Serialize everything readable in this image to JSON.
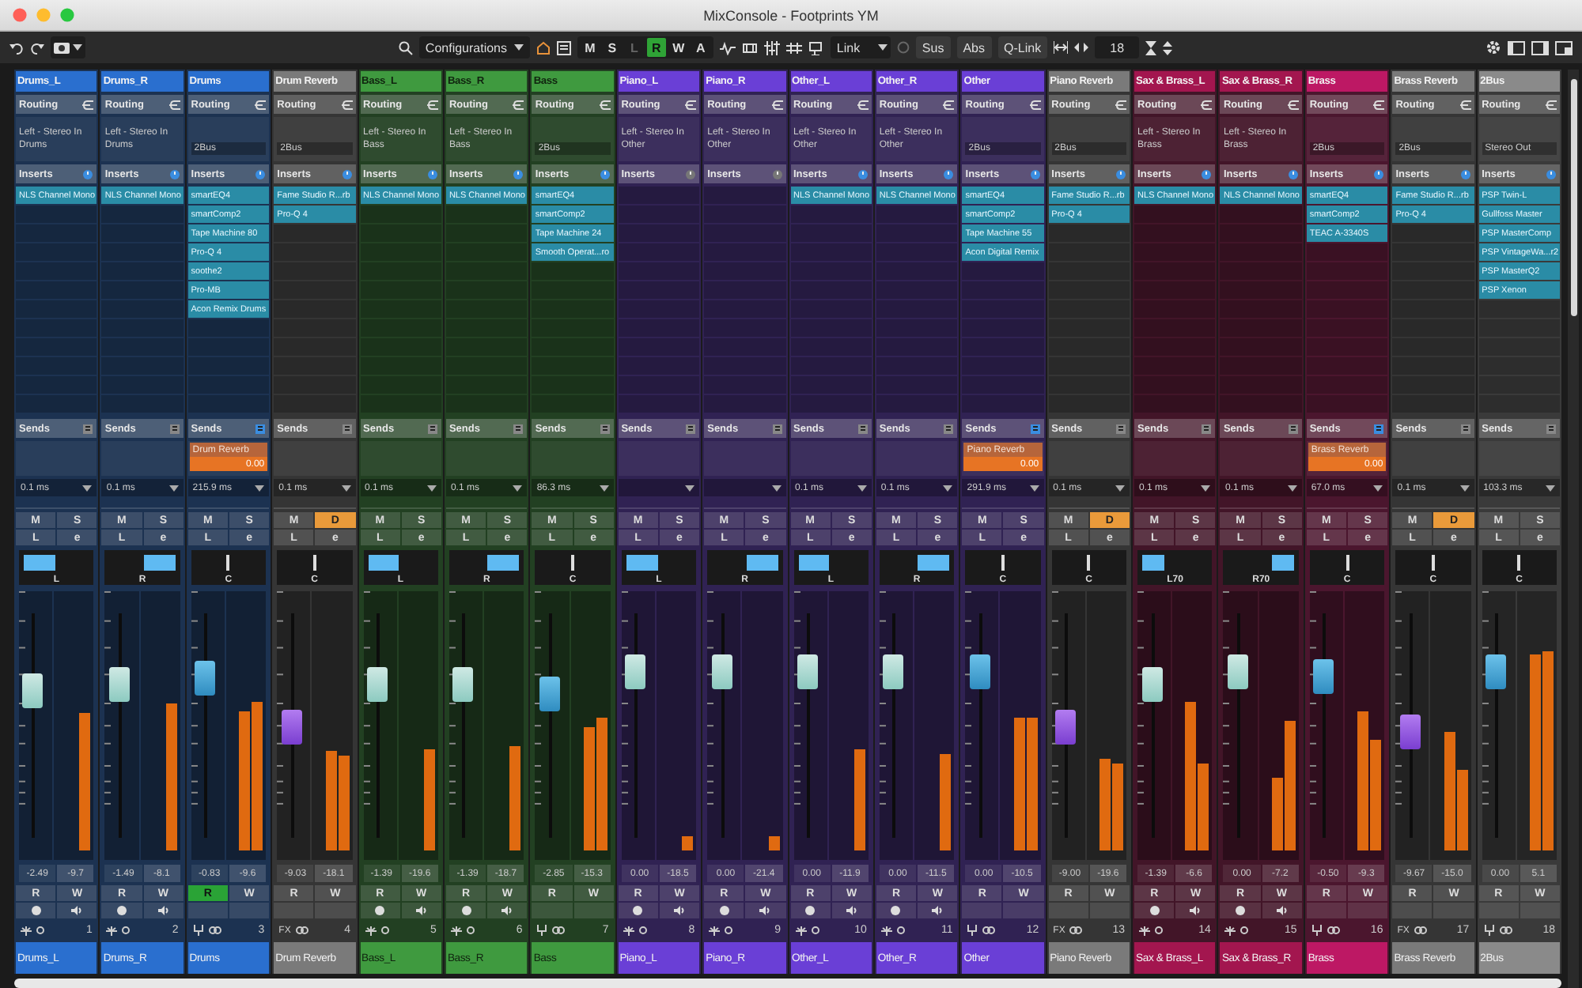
{
  "window": {
    "title": "MixConsole - Footprints YM"
  },
  "toolbar": {
    "configurations": "Configurations",
    "modes": [
      {
        "label": "M",
        "on": false,
        "disabled": false
      },
      {
        "label": "S",
        "on": false,
        "disabled": false
      },
      {
        "label": "L",
        "on": false,
        "disabled": true
      },
      {
        "label": "R",
        "on": true,
        "disabled": false
      },
      {
        "label": "W",
        "on": false,
        "disabled": false
      },
      {
        "label": "A",
        "on": false,
        "disabled": false
      }
    ],
    "link": "Link",
    "suspend": "Sus",
    "absolute": "Abs",
    "qlink": "Q-Link",
    "channel_count": "18"
  },
  "channels": [
    {
      "kind": "audio",
      "name": "Drums_L",
      "color": "#2a6fcf",
      "sections": [
        "Routing",
        "Inserts",
        "Sends"
      ],
      "input": "Left - Stereo In",
      "output": "Drums",
      "inserts_on": true,
      "inserts": [
        "NLS Channel Mono"
      ],
      "sends_on": false,
      "delay": "0.1 ms",
      "mute": "M",
      "solo": {
        "label": "S",
        "on": false
      },
      "listen": "L",
      "edit": "e",
      "pan": {
        "label": "L",
        "kind": "left"
      },
      "fader": {
        "level": 0.68
      },
      "meters": [
        {
          "level": 0.58
        }
      ],
      "volume": "-2.49",
      "peak": "-9.7",
      "read": {
        "label": "R",
        "on": false
      },
      "write": "W",
      "number": "1",
      "label": "Drums_L"
    },
    {
      "kind": "audio",
      "name": "Drums_R",
      "color": "#2a6fcf",
      "sections": [
        "Routing",
        "Inserts",
        "Sends"
      ],
      "input": "Left - Stereo In",
      "output": "Drums",
      "inserts_on": true,
      "inserts": [
        "NLS Channel Mono"
      ],
      "sends_on": false,
      "delay": "0.1 ms",
      "mute": "M",
      "solo": {
        "label": "S",
        "on": false
      },
      "listen": "L",
      "edit": "e",
      "pan": {
        "label": "R",
        "kind": "right"
      },
      "fader": {
        "level": 0.72
      },
      "meters": [
        {
          "level": 0.62
        }
      ],
      "volume": "-1.49",
      "peak": "-8.1",
      "read": {
        "label": "R",
        "on": false
      },
      "write": "W",
      "number": "2",
      "label": "Drums_R"
    },
    {
      "kind": "group",
      "name": "Drums",
      "color": "#2a6fcf",
      "sections": [
        "Routing",
        "Inserts",
        "Sends"
      ],
      "output": "2Bus",
      "inserts_on": true,
      "inserts": [
        "smartEQ4",
        "smartComp2",
        "Tape Machine 80",
        "Pro-Q 4",
        "soothe2",
        "Pro-MB",
        "Acon Remix Drums"
      ],
      "sends_on": true,
      "send": {
        "name": "Drum Reverb",
        "value": "0.00"
      },
      "delay": "215.9 ms",
      "mute": "M",
      "solo": {
        "label": "S",
        "on": false
      },
      "listen": "L",
      "edit": "e",
      "pan": {
        "label": "C",
        "kind": "center"
      },
      "fader": {
        "level": 0.75
      },
      "meters": [
        {
          "level": 0.59
        },
        {
          "level": 0.63
        }
      ],
      "volume": "-0.83",
      "peak": "-9.6",
      "read": {
        "label": "R",
        "on": true
      },
      "write": "W",
      "number": "3",
      "label": "Drums"
    },
    {
      "kind": "fx",
      "name": "Drum Reverb",
      "color": "#7a7a7a",
      "sections": [
        "Routing",
        "Inserts",
        "Sends"
      ],
      "output": "2Bus",
      "inserts_on": true,
      "inserts": [
        "Fame Studio R...rb",
        "Pro-Q 4"
      ],
      "sends_on": false,
      "delay": "0.1 ms",
      "mute": "M",
      "solo": {
        "label": "D",
        "on": true
      },
      "listen": "L",
      "edit": "e",
      "pan": {
        "label": "C",
        "kind": "center"
      },
      "fader": {
        "level": 0.49
      },
      "meters": [
        {
          "level": 0.42
        },
        {
          "level": 0.4
        }
      ],
      "volume": "-9.03",
      "peak": "-18.1",
      "read": {
        "label": "R",
        "on": false
      },
      "write": "W",
      "tag": "FX",
      "number": "4",
      "label": "Drum Reverb"
    },
    {
      "kind": "audio",
      "name": "Bass_L",
      "color": "#3f9a3f",
      "sections": [
        "Routing",
        "Inserts",
        "Sends"
      ],
      "input": "Left - Stereo In",
      "output": "Bass",
      "inserts_on": true,
      "inserts": [
        "NLS Channel Mono"
      ],
      "sends_on": false,
      "delay": "0.1 ms",
      "mute": "M",
      "solo": {
        "label": "S",
        "on": false
      },
      "listen": "L",
      "edit": "e",
      "pan": {
        "label": "L",
        "kind": "left"
      },
      "fader": {
        "level": 0.72
      },
      "meters": [
        {
          "level": 0.43
        }
      ],
      "volume": "-1.39",
      "peak": "-19.6",
      "read": {
        "label": "R",
        "on": false
      },
      "write": "W",
      "number": "5",
      "label": "Bass_L"
    },
    {
      "kind": "audio",
      "name": "Bass_R",
      "color": "#3f9a3f",
      "sections": [
        "Routing",
        "Inserts",
        "Sends"
      ],
      "input": "Left - Stereo In",
      "output": "Bass",
      "inserts_on": true,
      "inserts": [
        "NLS Channel Mono"
      ],
      "sends_on": false,
      "delay": "0.1 ms",
      "mute": "M",
      "solo": {
        "label": "S",
        "on": false
      },
      "listen": "L",
      "edit": "e",
      "pan": {
        "label": "R",
        "kind": "right"
      },
      "fader": {
        "level": 0.72
      },
      "meters": [
        {
          "level": 0.44
        }
      ],
      "volume": "-1.39",
      "peak": "-18.7",
      "read": {
        "label": "R",
        "on": false
      },
      "write": "W",
      "number": "6",
      "label": "Bass_R"
    },
    {
      "kind": "group",
      "name": "Bass",
      "color": "#3f9a3f",
      "sections": [
        "Routing",
        "Inserts",
        "Sends"
      ],
      "output": "2Bus",
      "inserts_on": true,
      "inserts": [
        "smartEQ4",
        "smartComp2",
        "Tape Machine 24",
        "Smooth Operat...ro"
      ],
      "sends_on": false,
      "delay": "86.3 ms",
      "mute": "M",
      "solo": {
        "label": "S",
        "on": false
      },
      "listen": "L",
      "edit": "e",
      "pan": {
        "label": "C",
        "kind": "center"
      },
      "fader": {
        "level": 0.67
      },
      "meters": [
        {
          "level": 0.52
        },
        {
          "level": 0.56
        }
      ],
      "volume": "-2.85",
      "peak": "-15.3",
      "read": {
        "label": "R",
        "on": false
      },
      "write": "W",
      "number": "7",
      "label": "Bass"
    },
    {
      "kind": "audio",
      "name": "Piano_L",
      "color": "#6a3fd6",
      "sections": [
        "Routing",
        "Inserts",
        "Sends"
      ],
      "input": "Left - Stereo In",
      "output": "Other",
      "inserts_on": false,
      "sends_on": false,
      "mute": "M",
      "solo": {
        "label": "S",
        "on": false
      },
      "listen": "L",
      "edit": "e",
      "pan": {
        "label": "L",
        "kind": "left"
      },
      "fader": {
        "level": 0.78
      },
      "meters": [
        {
          "level": 0.06
        }
      ],
      "volume": "0.00",
      "peak": "-18.5",
      "read": {
        "label": "R",
        "on": false
      },
      "write": "W",
      "number": "8",
      "label": "Piano_L"
    },
    {
      "kind": "audio",
      "name": "Piano_R",
      "color": "#6a3fd6",
      "sections": [
        "Routing",
        "Inserts",
        "Sends"
      ],
      "input": "Left - Stereo In",
      "output": "Other",
      "inserts_on": false,
      "sends_on": false,
      "mute": "M",
      "solo": {
        "label": "S",
        "on": false
      },
      "listen": "L",
      "edit": "e",
      "pan": {
        "label": "R",
        "kind": "right"
      },
      "fader": {
        "level": 0.78
      },
      "meters": [
        {
          "level": 0.06
        }
      ],
      "volume": "0.00",
      "peak": "-21.4",
      "read": {
        "label": "R",
        "on": false
      },
      "write": "W",
      "number": "9",
      "label": "Piano_R"
    },
    {
      "kind": "audio",
      "name": "Other_L",
      "color": "#6a3fd6",
      "sections": [
        "Routing",
        "Inserts",
        "Sends"
      ],
      "input": "Left - Stereo In",
      "output": "Other",
      "inserts_on": true,
      "inserts": [
        "NLS Channel Mono"
      ],
      "sends_on": false,
      "delay": "0.1 ms",
      "mute": "M",
      "solo": {
        "label": "S",
        "on": false
      },
      "listen": "L",
      "edit": "e",
      "pan": {
        "label": "L",
        "kind": "left"
      },
      "fader": {
        "level": 0.78
      },
      "meters": [
        {
          "level": 0.43
        }
      ],
      "volume": "0.00",
      "peak": "-11.9",
      "read": {
        "label": "R",
        "on": false
      },
      "write": "W",
      "number": "10",
      "label": "Other_L"
    },
    {
      "kind": "audio",
      "name": "Other_R",
      "color": "#6a3fd6",
      "sections": [
        "Routing",
        "Inserts",
        "Sends"
      ],
      "input": "Left - Stereo In",
      "output": "Other",
      "inserts_on": true,
      "inserts": [
        "NLS Channel Mono"
      ],
      "sends_on": false,
      "delay": "0.1 ms",
      "mute": "M",
      "solo": {
        "label": "S",
        "on": false
      },
      "listen": "L",
      "edit": "e",
      "pan": {
        "label": "R",
        "kind": "right"
      },
      "fader": {
        "level": 0.78
      },
      "meters": [
        {
          "level": 0.41
        }
      ],
      "volume": "0.00",
      "peak": "-11.5",
      "read": {
        "label": "R",
        "on": false
      },
      "write": "W",
      "number": "11",
      "label": "Other_R"
    },
    {
      "kind": "group",
      "name": "Other",
      "color": "#6a3fd6",
      "sections": [
        "Routing",
        "Inserts",
        "Sends"
      ],
      "output": "2Bus",
      "inserts_on": true,
      "inserts": [
        "smartEQ4",
        "smartComp2",
        "Tape Machine 55",
        "Acon Digital Remix"
      ],
      "sends_on": true,
      "send": {
        "name": "Piano Reverb",
        "value": "0.00"
      },
      "delay": "291.9 ms",
      "mute": "M",
      "solo": {
        "label": "S",
        "on": false
      },
      "listen": "L",
      "edit": "e",
      "pan": {
        "label": "C",
        "kind": "center"
      },
      "fader": {
        "level": 0.78
      },
      "meters": [
        {
          "level": 0.56
        },
        {
          "level": 0.56
        }
      ],
      "volume": "0.00",
      "peak": "-10.5",
      "read": {
        "label": "R",
        "on": false
      },
      "write": "W",
      "number": "12",
      "label": "Other"
    },
    {
      "kind": "fx",
      "name": "Piano Reverb",
      "color": "#7a7a7a",
      "sections": [
        "Routing",
        "Inserts",
        "Sends"
      ],
      "output": "2Bus",
      "inserts_on": true,
      "inserts": [
        "Fame Studio R...rb",
        "Pro-Q 4"
      ],
      "sends_on": false,
      "delay": "0.1 ms",
      "mute": "M",
      "solo": {
        "label": "D",
        "on": true
      },
      "listen": "L",
      "edit": "e",
      "pan": {
        "label": "C",
        "kind": "center"
      },
      "fader": {
        "level": 0.49
      },
      "meters": [
        {
          "level": 0.39
        },
        {
          "level": 0.37
        }
      ],
      "volume": "-9.00",
      "peak": "-19.6",
      "read": {
        "label": "R",
        "on": false
      },
      "write": "W",
      "tag": "FX",
      "number": "13",
      "label": "Piano Reverb"
    },
    {
      "kind": "audio",
      "name": "Sax & Brass_L",
      "color": "#a3164f",
      "sections": [
        "Routing",
        "Inserts",
        "Sends"
      ],
      "input": "Left - Stereo In",
      "output": "Brass",
      "inserts_on": true,
      "inserts": [
        "NLS Channel Mono"
      ],
      "sends_on": false,
      "delay": "0.1 ms",
      "mute": "M",
      "solo": {
        "label": "S",
        "on": false
      },
      "listen": "L",
      "edit": "e",
      "pan": {
        "label": "L70",
        "kind": "left"
      },
      "fader": {
        "level": 0.72
      },
      "meters": [
        {
          "level": 0.63
        },
        {
          "level": 0.37
        }
      ],
      "volume": "-1.39",
      "peak": "-6.6",
      "read": {
        "label": "R",
        "on": false
      },
      "write": "W",
      "number": "14",
      "label": "Sax & Brass_L"
    },
    {
      "kind": "audio",
      "name": "Sax & Brass_R",
      "color": "#a3164f",
      "sections": [
        "Routing",
        "Inserts",
        "Sends"
      ],
      "input": "Left - Stereo In",
      "output": "Brass",
      "inserts_on": true,
      "inserts": [
        "NLS Channel Mono"
      ],
      "sends_on": false,
      "delay": "0.1 ms",
      "mute": "M",
      "solo": {
        "label": "S",
        "on": false
      },
      "listen": "L",
      "edit": "e",
      "pan": {
        "label": "R70",
        "kind": "right"
      },
      "fader": {
        "level": 0.78
      },
      "meters": [
        {
          "level": 0.31
        },
        {
          "level": 0.55
        }
      ],
      "volume": "0.00",
      "peak": "-7.2",
      "read": {
        "label": "R",
        "on": false
      },
      "write": "W",
      "number": "15",
      "label": "Sax & Brass_R"
    },
    {
      "kind": "group",
      "name": "Brass",
      "color": "#bd1864",
      "sections": [
        "Routing",
        "Inserts",
        "Sends"
      ],
      "output": "2Bus",
      "inserts_on": true,
      "inserts": [
        "smartEQ4",
        "smartComp2",
        "TEAC A-3340S"
      ],
      "sends_on": true,
      "send": {
        "name": "Brass Reverb",
        "value": "0.00"
      },
      "delay": "67.0 ms",
      "mute": "M",
      "solo": {
        "label": "S",
        "on": false
      },
      "listen": "L",
      "edit": "e",
      "pan": {
        "label": "C",
        "kind": "center"
      },
      "fader": {
        "level": 0.76
      },
      "meters": [
        {
          "level": 0.59
        },
        {
          "level": 0.47
        }
      ],
      "volume": "-0.50",
      "peak": "-9.3",
      "read": {
        "label": "R",
        "on": false
      },
      "write": "W",
      "number": "16",
      "label": "Brass"
    },
    {
      "kind": "fx",
      "name": "Brass Reverb",
      "color": "#7a7a7a",
      "sections": [
        "Routing",
        "Inserts",
        "Sends"
      ],
      "output": "2Bus",
      "inserts_on": true,
      "inserts": [
        "Fame Studio R...rb",
        "Pro-Q 4"
      ],
      "sends_on": false,
      "delay": "0.1 ms",
      "mute": "M",
      "solo": {
        "label": "D",
        "on": true
      },
      "listen": "L",
      "edit": "e",
      "pan": {
        "label": "C",
        "kind": "center"
      },
      "fader": {
        "level": 0.47
      },
      "meters": [
        {
          "level": 0.5
        },
        {
          "level": 0.34
        }
      ],
      "volume": "-9.67",
      "peak": "-15.0",
      "read": {
        "label": "R",
        "on": false
      },
      "write": "W",
      "tag": "FX",
      "number": "17",
      "label": "Brass Reverb"
    },
    {
      "kind": "group",
      "name": "2Bus",
      "color": "#8a8a8a",
      "sections": [
        "Routing",
        "Inserts",
        "Sends"
      ],
      "output": "Stereo Out",
      "inserts_on": true,
      "inserts": [
        "PSP Twin-L",
        "Gullfoss Master",
        "PSP MasterComp",
        "PSP VintageWa...r2",
        "PSP MasterQ2",
        "PSP Xenon"
      ],
      "sends_on": false,
      "delay": "103.3 ms",
      "mute": "M",
      "solo": {
        "label": "S",
        "on": false
      },
      "listen": "L",
      "edit": "e",
      "pan": {
        "label": "C",
        "kind": "center"
      },
      "fader": {
        "level": 0.78
      },
      "meters": [
        {
          "level": 0.83
        },
        {
          "level": 0.84
        }
      ],
      "volume": "0.00",
      "peak": "5.1",
      "read": {
        "label": "R",
        "on": false
      },
      "write": "W",
      "number": "18",
      "label": "2Bus"
    }
  ]
}
